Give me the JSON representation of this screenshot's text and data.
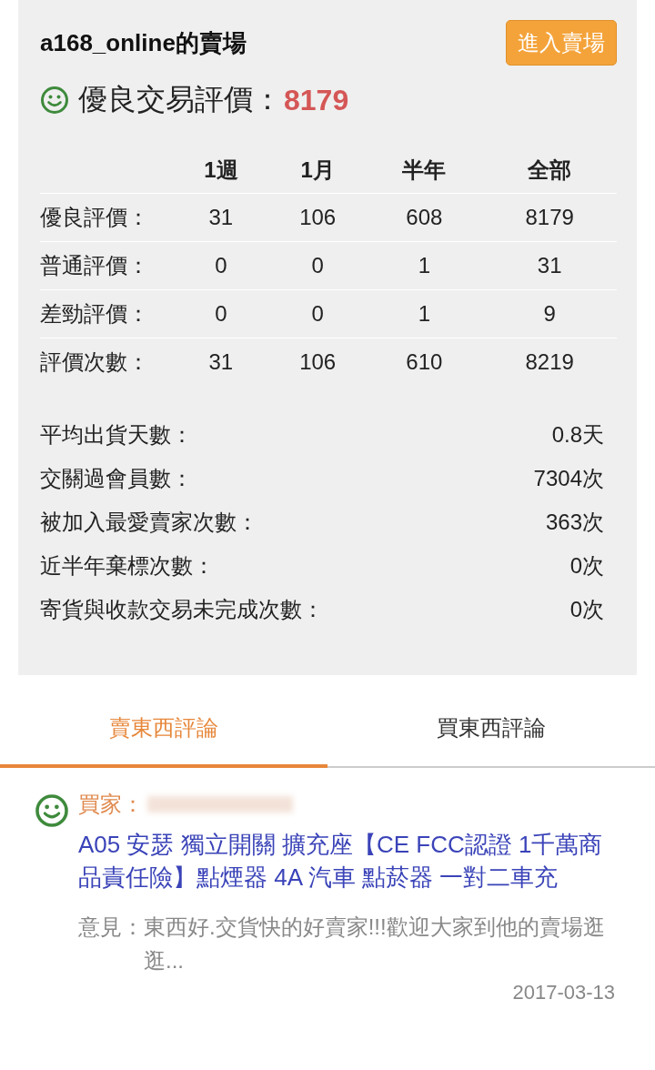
{
  "shop": {
    "title": "a168_online的賣場",
    "enter_button": "進入賣場",
    "score_label": "優良交易評價：",
    "score": "8179"
  },
  "ratings": {
    "columns": [
      "1週",
      "1月",
      "半年",
      "全部"
    ],
    "rows": [
      {
        "label": "優良評價：",
        "values": [
          "31",
          "106",
          "608",
          "8179"
        ]
      },
      {
        "label": "普通評價：",
        "values": [
          "0",
          "0",
          "1",
          "31"
        ]
      },
      {
        "label": "差勁評價：",
        "values": [
          "0",
          "0",
          "1",
          "9"
        ]
      },
      {
        "label": "評價次數：",
        "values": [
          "31",
          "106",
          "610",
          "8219"
        ]
      }
    ]
  },
  "stats": [
    {
      "label": "平均出貨天數：",
      "value": "0.8天"
    },
    {
      "label": "交關過會員數：",
      "value": "7304次"
    },
    {
      "label": "被加入最愛賣家次數：",
      "value": "363次"
    },
    {
      "label": "近半年棄標次數：",
      "value": "0次"
    },
    {
      "label": "寄貨與收款交易未完成次數：",
      "value": "0次"
    }
  ],
  "tabs": [
    {
      "label": "賣東西評論",
      "selected": true
    },
    {
      "label": "買東西評論",
      "selected": false
    }
  ],
  "reviews": [
    {
      "buyer_label": "買家：",
      "item": "A05 安瑟 獨立開關 擴充座【CE FCC認證 1千萬商品責任險】點煙器 4A 汽車 點菸器 一對二車充",
      "opinion_label": "意見：",
      "opinion": "東西好.交貨快的好賣家!!!歡迎大家到他的賣場逛逛...",
      "date": "2017-03-13"
    }
  ]
}
